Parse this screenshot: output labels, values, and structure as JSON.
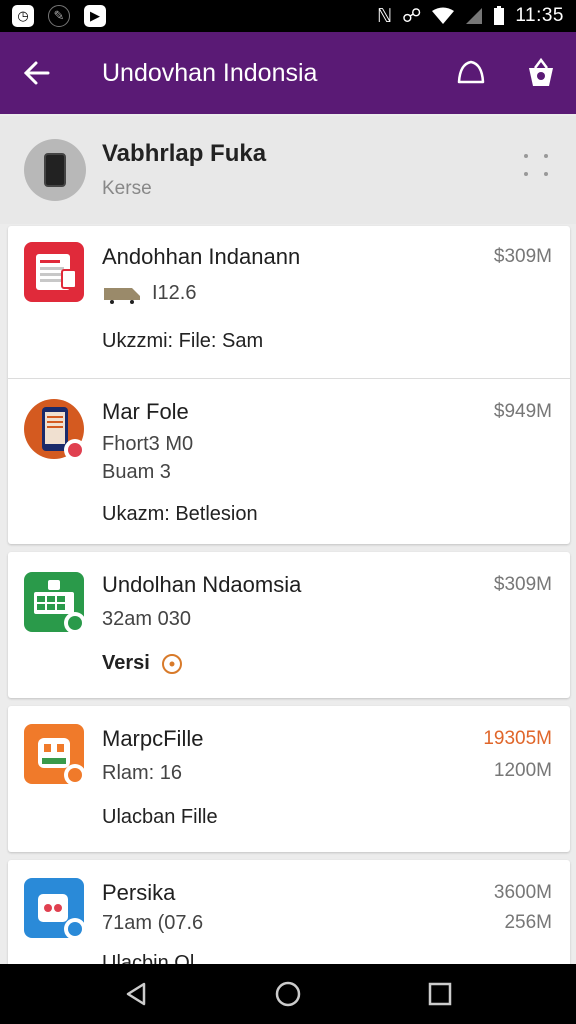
{
  "status_bar": {
    "time": "11:35"
  },
  "app_bar": {
    "title": "Undovhan Indonsia"
  },
  "account": {
    "name": "Vabhrlap Fuka",
    "subtitle": "Kerse"
  },
  "items": [
    {
      "title": "Andohhan Indanann",
      "line2": "I12.6",
      "line3": "Ukzzmi: File: Sam",
      "size": "$309M",
      "icon_color": "#e02a3a",
      "icon": "document-icon"
    },
    {
      "title": "Mar Fole",
      "line2": "Fhort3 M0",
      "line2b": "Buam 3",
      "line3": "Ukazm: Betlesion",
      "size": "$949M",
      "icon_color": "#d45a20",
      "icon": "phone-app-icon"
    },
    {
      "title": "Undolhan Ndaomsia",
      "line2": "32am 030",
      "line3": "Versi",
      "size": "$309M",
      "icon_color": "#2a9a4a",
      "icon": "grid-app-icon"
    },
    {
      "title": "MarpcFille",
      "line2": "Rlam: 16",
      "line3": "Ulacban Fille",
      "size": "19305M",
      "size2": "1200M",
      "size_color": "#e0662a",
      "icon_color": "#f07a2a",
      "icon": "robot-app-icon"
    },
    {
      "title": "Persika",
      "line2": "71am (07.6",
      "line3": "Ulacbin Ol",
      "size": "3600M",
      "size2": "256M",
      "icon_color": "#2a8ad8",
      "icon": "cart-app-icon"
    }
  ]
}
